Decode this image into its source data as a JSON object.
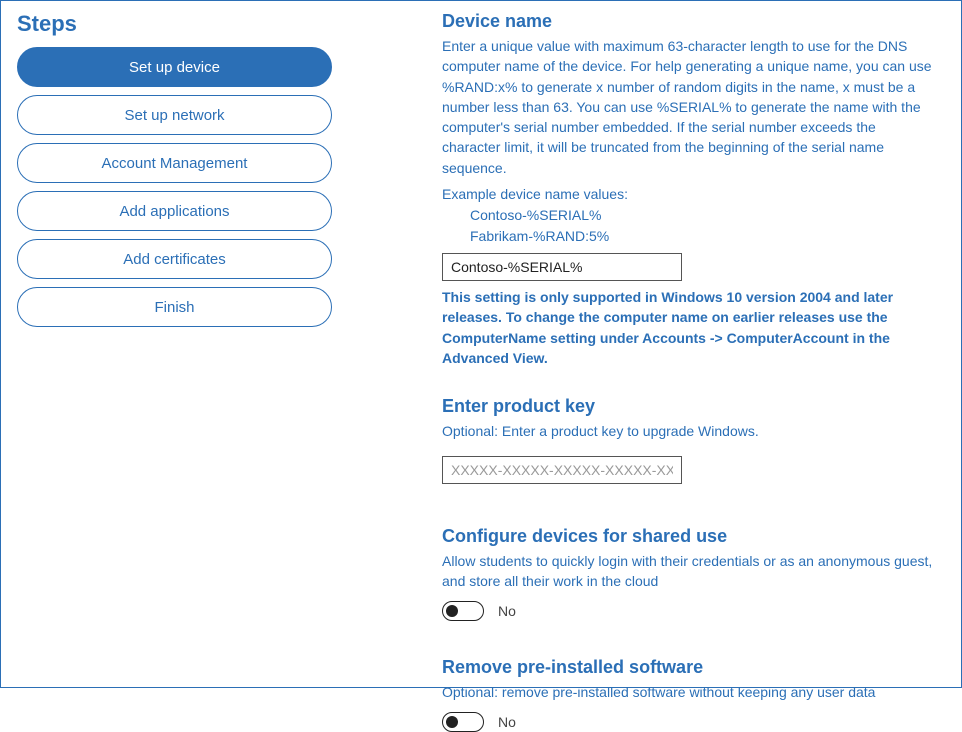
{
  "sidebar": {
    "title": "Steps",
    "items": [
      {
        "label": "Set up device",
        "active": true
      },
      {
        "label": "Set up network",
        "active": false
      },
      {
        "label": "Account Management",
        "active": false
      },
      {
        "label": "Add applications",
        "active": false
      },
      {
        "label": "Add certificates",
        "active": false
      },
      {
        "label": "Finish",
        "active": false
      }
    ]
  },
  "deviceName": {
    "title": "Device name",
    "desc": "Enter a unique value with maximum 63-character length to use for the DNS computer name of the device. For help generating a unique name, you can use %RAND:x% to generate x number of random digits in the name, x must be a number less than 63. You can use %SERIAL% to generate the name with the computer's serial number embedded. If the serial number exceeds the character limit, it will be truncated from the beginning of the serial name sequence.",
    "exampleLabel": "Example device name values:",
    "example1": "Contoso-%SERIAL%",
    "example2": "Fabrikam-%RAND:5%",
    "inputValue": "Contoso-%SERIAL%",
    "note": "This setting is only supported in Windows 10 version 2004 and later releases. To change the computer name on earlier releases use the ComputerName setting under Accounts -> ComputerAccount in the Advanced View."
  },
  "productKey": {
    "title": "Enter product key",
    "desc": "Optional: Enter a product key to upgrade Windows.",
    "placeholder": "XXXXX-XXXXX-XXXXX-XXXXX-XXXXX",
    "value": ""
  },
  "sharedUse": {
    "title": "Configure devices for shared use",
    "desc": "Allow students to quickly login with their credentials or as an anonymous guest, and store all their work in the cloud",
    "toggleLabel": "No"
  },
  "removeSoftware": {
    "title": "Remove pre-installed software",
    "desc": "Optional: remove pre-installed software without keeping any user data",
    "toggleLabel": "No"
  }
}
